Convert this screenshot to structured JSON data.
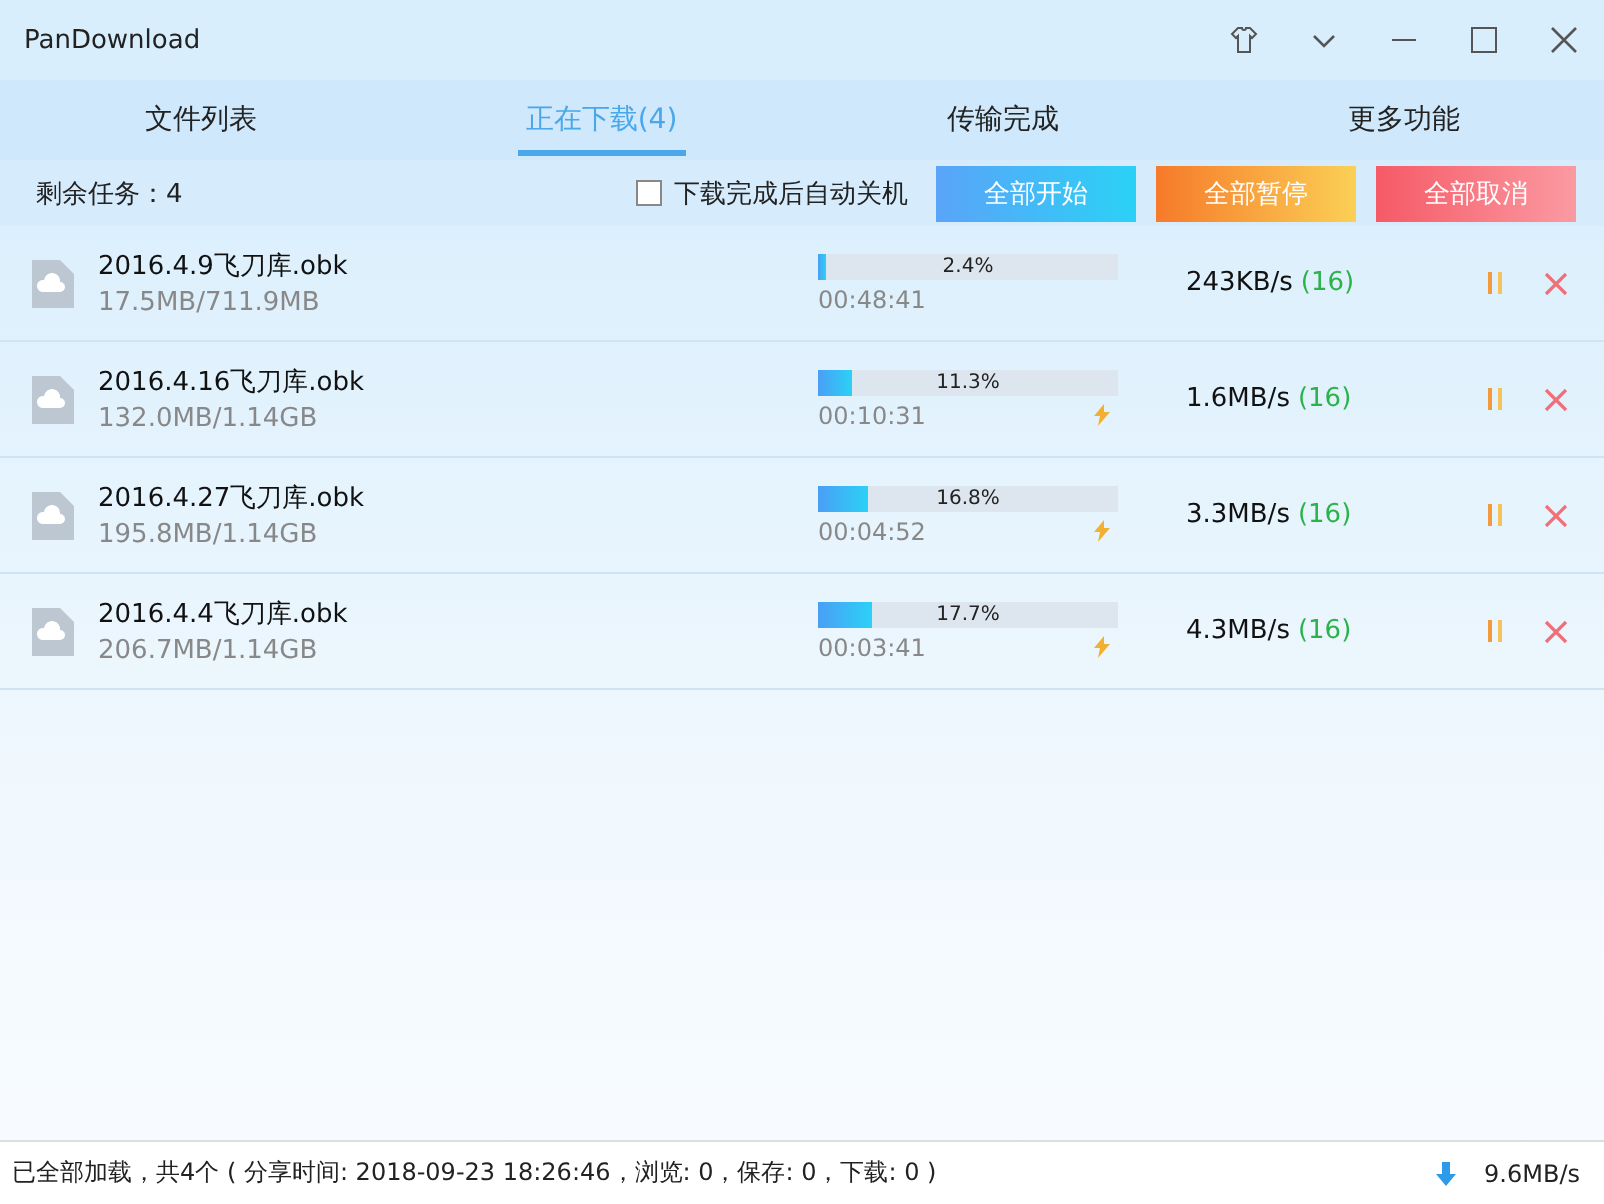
{
  "window": {
    "title": "PanDownload"
  },
  "tabs": [
    {
      "label": "文件列表",
      "selected": false
    },
    {
      "label": "正在下载(4)",
      "selected": true
    },
    {
      "label": "传输完成",
      "selected": false
    },
    {
      "label": "更多功能",
      "selected": false
    }
  ],
  "toolbar": {
    "remaining": "剩余任务：4",
    "shutdown": {
      "label": "下载完成后自动关机",
      "checked": false
    },
    "buttons": [
      {
        "label": "全部开始",
        "kind": "start"
      },
      {
        "label": "全部暂停",
        "kind": "pause"
      },
      {
        "label": "全部取消",
        "kind": "cancel"
      }
    ]
  },
  "downloads": [
    {
      "name": "2016.4.9飞刀库.obk",
      "size": "17.5MB/711.9MB",
      "level": 0.024,
      "percent": "2.4%",
      "time": "00:48:41",
      "boosted": false,
      "speed": "243KB/s",
      "connections": "(16)"
    },
    {
      "name": "2016.4.16飞刀库.obk",
      "size": "132.0MB/1.14GB",
      "level": 0.113,
      "percent": "11.3%",
      "time": "00:10:31",
      "boosted": true,
      "speed": "1.6MB/s",
      "connections": "(16)"
    },
    {
      "name": "2016.4.27飞刀库.obk",
      "size": "195.8MB/1.14GB",
      "level": 0.168,
      "percent": "16.8%",
      "time": "00:04:52",
      "boosted": true,
      "speed": "3.3MB/s",
      "connections": "(16)"
    },
    {
      "name": "2016.4.4飞刀库.obk",
      "size": "206.7MB/1.14GB",
      "level": 0.177,
      "percent": "17.7%",
      "time": "00:03:41",
      "boosted": true,
      "speed": "4.3MB/s",
      "connections": "(16)"
    }
  ],
  "status_bar": {
    "text": "已全部加载，共4个 ( 分享时间: 2018-09-23 18:26:46，浏览: 0，保存: 0，下载: 0 )",
    "speed": "9.6MB/s"
  }
}
